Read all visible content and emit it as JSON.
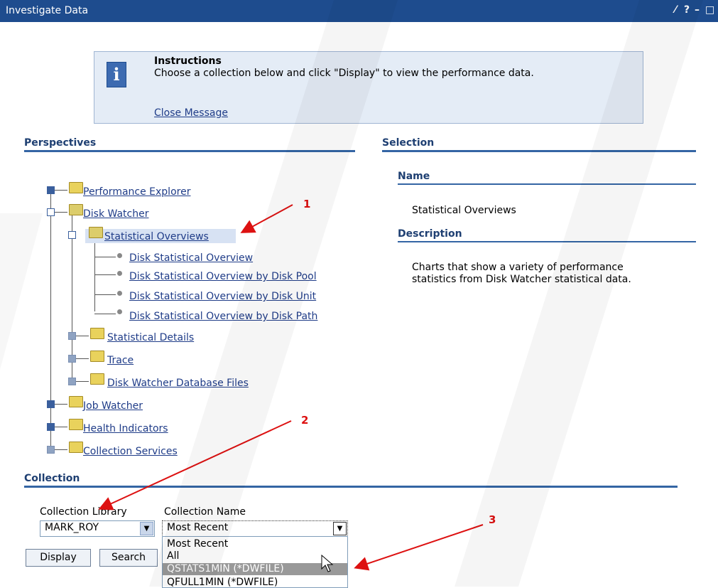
{
  "window": {
    "title": "Investigate Data",
    "controls": [
      "⁄",
      "?",
      "–",
      "□"
    ]
  },
  "instructions": {
    "heading": "Instructions",
    "text": "Choose a collection below and click \"Display\" to view the performance data.",
    "close_link": "Close Message"
  },
  "perspectives": {
    "title": "Perspectives",
    "tree": {
      "performance_explorer": "Performance Explorer",
      "disk_watcher": "Disk Watcher",
      "statistical_overviews": "Statistical Overviews",
      "overview_items": [
        "Disk Statistical Overview",
        "Disk Statistical Overview by Disk Pool",
        "Disk Statistical Overview by Disk Unit",
        "Disk Statistical Overview by Disk Path"
      ],
      "statistical_details": "Statistical Details",
      "trace": "Trace",
      "database_files": "Disk Watcher Database Files",
      "job_watcher": "Job Watcher",
      "health_indicators": "Health Indicators",
      "collection_services": "Collection Services"
    }
  },
  "selection": {
    "title": "Selection",
    "name_label": "Name",
    "name_value": "Statistical Overviews",
    "description_label": "Description",
    "description_value_line1": "Charts that show a variety of performance",
    "description_value_line2": "statistics from Disk Watcher statistical data."
  },
  "collection": {
    "title": "Collection",
    "library_label": "Collection Library",
    "library_value": "MARK_ROY",
    "name_label": "Collection Name",
    "name_value": "Most Recent",
    "options": [
      "Most Recent",
      "All",
      "QSTATS1MIN (*DWFILE)",
      "QFULL1MIN (*DWFILE)"
    ],
    "selected_option": "QSTATS1MIN (*DWFILE)",
    "display_button": "Display",
    "search_button": "Search"
  },
  "callouts": [
    "1",
    "2",
    "3"
  ],
  "colors": {
    "titlebar": "#1e4c8e",
    "section_title": "#1e3f72",
    "rule": "#3465a4",
    "link": "#1f3c88",
    "callout": "#dd1111"
  }
}
